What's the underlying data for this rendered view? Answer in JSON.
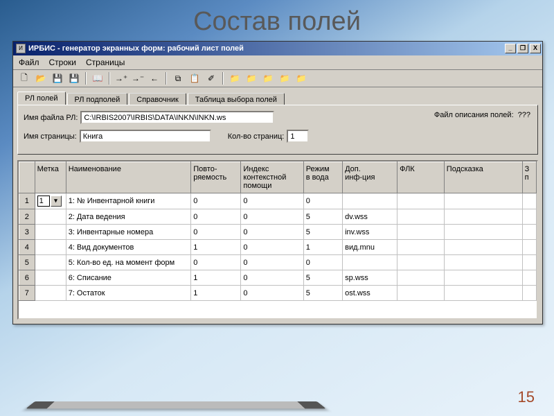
{
  "slide": {
    "title": "Состав полей",
    "page_number": "15"
  },
  "window": {
    "title": "ИРБИС - генератор экранных форм: рабочий лист полей",
    "buttons": {
      "min": "_",
      "restore": "❐",
      "close": "X"
    }
  },
  "menu": [
    "Файл",
    "Строки",
    "Страницы"
  ],
  "toolbar_icons": [
    "new-icon",
    "open-icon",
    "save-icon",
    "saveas-icon",
    "sep",
    "book-icon",
    "sep",
    "arrow-right-plus-icon",
    "arrow-right-minus-icon",
    "arrow-left-icon",
    "sep",
    "copy-icon",
    "paste-icon",
    "paint-icon",
    "sep",
    "folder-yellow-icon",
    "folder-red-icon",
    "folder-green-icon",
    "folder-plus-icon",
    "folder-x-icon"
  ],
  "toolbar_glyphs": {
    "new-icon": "🗋",
    "open-icon": "📂",
    "save-icon": "💾",
    "saveas-icon": "💾",
    "book-icon": "📖",
    "arrow-right-plus-icon": "→⁺",
    "arrow-right-minus-icon": "→⁻",
    "arrow-left-icon": "←",
    "copy-icon": "⧉",
    "paste-icon": "📋",
    "paint-icon": "✐",
    "folder-yellow-icon": "📁",
    "folder-red-icon": "📁",
    "folder-green-icon": "📁",
    "folder-plus-icon": "📁",
    "folder-x-icon": "📁"
  },
  "tabs": [
    {
      "label": "РЛ полей",
      "active": true
    },
    {
      "label": "РЛ подполей",
      "active": false
    },
    {
      "label": "Справочник",
      "active": false
    },
    {
      "label": "Таблица выбора полей",
      "active": false
    }
  ],
  "form": {
    "file_label": "Имя файла РЛ:",
    "file_value": "C:\\IRBIS2007\\IRBIS\\DATA\\INKN\\INKN.ws",
    "page_label": "Имя страницы:",
    "page_value": "Книга",
    "count_label": "Кол-во страниц:",
    "count_value": "1",
    "desc_label": "Файл описания полей:",
    "desc_value": "???"
  },
  "grid": {
    "columns": [
      "Метка",
      "Наименование",
      "Повто-\nряемость",
      "Индекс\nконтекстной\nпомощи",
      "Режим\nв вода",
      "Доп.\nинф-ция",
      "ФЛК",
      "Подсказка",
      "З\nп"
    ],
    "rows": [
      {
        "n": "1",
        "metka": "1",
        "name": "1: № Инвентарной книги",
        "rep": "0",
        "idx": "0",
        "mode": "0",
        "dop": "",
        "flk": "",
        "hint": ""
      },
      {
        "n": "2",
        "metka": "",
        "name": "2: Дата ведения",
        "rep": "0",
        "idx": "0",
        "mode": "5",
        "dop": "dv.wss",
        "flk": "",
        "hint": ""
      },
      {
        "n": "3",
        "metka": "",
        "name": "3: Инвентарные номера",
        "rep": "0",
        "idx": "0",
        "mode": "5",
        "dop": "inv.wss",
        "flk": "",
        "hint": ""
      },
      {
        "n": "4",
        "metka": "",
        "name": "4: Вид документов",
        "rep": "1",
        "idx": "0",
        "mode": "1",
        "dop": "вид.mnu",
        "flk": "",
        "hint": ""
      },
      {
        "n": "5",
        "metka": "",
        "name": "5: Кол-во ед. на момент форм",
        "rep": "0",
        "idx": "0",
        "mode": "0",
        "dop": "",
        "flk": "",
        "hint": ""
      },
      {
        "n": "6",
        "metka": "",
        "name": "6: Списание",
        "rep": "1",
        "idx": "0",
        "mode": "5",
        "dop": "sp.wss",
        "flk": "",
        "hint": ""
      },
      {
        "n": "7",
        "metka": "",
        "name": "7: Остаток",
        "rep": "1",
        "idx": "0",
        "mode": "5",
        "dop": "ost.wss",
        "flk": "",
        "hint": ""
      }
    ]
  }
}
